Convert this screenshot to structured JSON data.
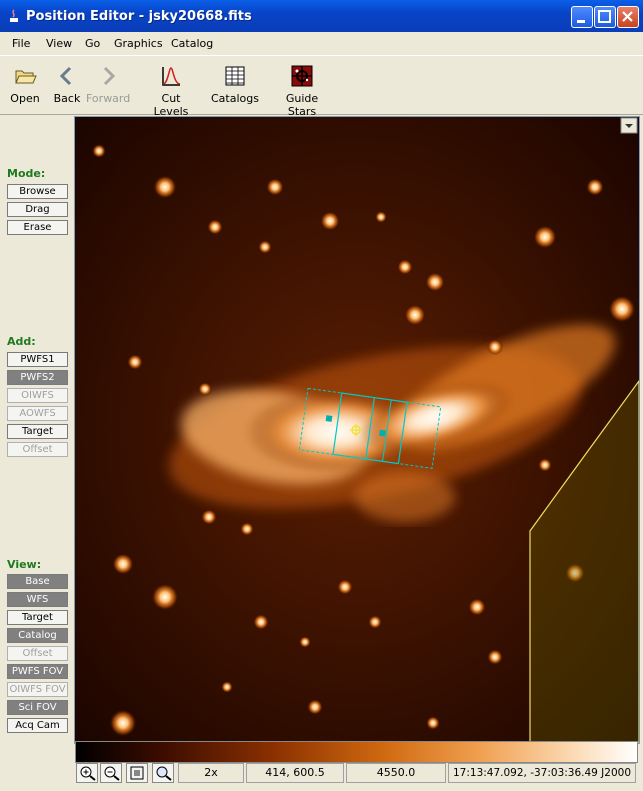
{
  "window": {
    "title": "Position Editor - jsky20668.fits"
  },
  "menu": [
    "File",
    "View",
    "Go",
    "Graphics",
    "Catalog"
  ],
  "toolbar": {
    "open": "Open",
    "back": "Back",
    "forward": "Forward",
    "cut_levels": "Cut Levels",
    "catalogs": "Catalogs",
    "guide_stars": "Guide Stars"
  },
  "sidebar": {
    "mode_label": "Mode:",
    "mode_buttons": [
      "Browse",
      "Drag",
      "Erase"
    ],
    "add_label": "Add:",
    "add_buttons": [
      "PWFS1",
      "PWFS2",
      "OIWFS",
      "AOWFS",
      "Target",
      "Offset"
    ],
    "view_label": "View:",
    "view_buttons": [
      "Base",
      "WFS",
      "Target",
      "Catalog",
      "Offset",
      "PWFS FOV",
      "OIWFS FOV",
      "Sci FOV",
      "Acq Cam"
    ]
  },
  "status": {
    "zoom": "2x",
    "pixel": "414, 600.5",
    "value": "4550.0",
    "coords": "17:13:47.092, -37:03:36.49 J2000"
  },
  "colors": {
    "title_bar": "#0A4FD8",
    "section_label": "#1E7A1E",
    "fov_overlay": "#00C8C8",
    "yellow_region": "#F0E060"
  }
}
